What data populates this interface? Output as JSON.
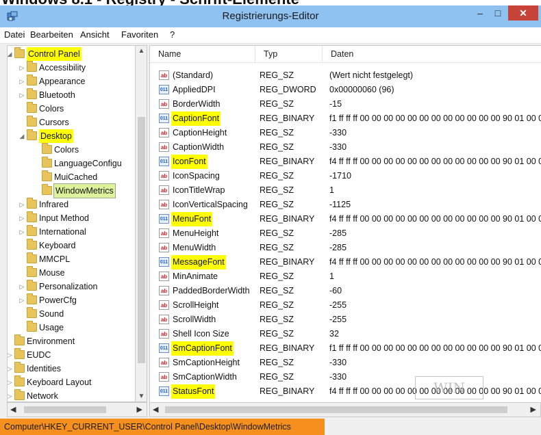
{
  "page_heading": "Windows 8.1 - Registry - Schrift-Elemente",
  "window": {
    "title": "Registrierungs-Editor",
    "controls": {
      "minimize": "–",
      "maximize": "□",
      "close": "✕"
    }
  },
  "menu": [
    "Datei",
    "Bearbeiten",
    "Ansicht",
    "Favoriten",
    "?"
  ],
  "tree": {
    "items": [
      {
        "label": "Control Panel",
        "expander": "◢",
        "highlight": "yellow"
      },
      {
        "label": "Accessibility",
        "expander": "▷"
      },
      {
        "label": "Appearance",
        "expander": "▷"
      },
      {
        "label": "Bluetooth",
        "expander": "▷"
      },
      {
        "label": "Colors",
        "expander": ""
      },
      {
        "label": "Cursors",
        "expander": ""
      },
      {
        "label": "Desktop",
        "expander": "◢",
        "highlight": "yellow"
      },
      {
        "label": "Colors",
        "expander": ""
      },
      {
        "label": "LanguageConfigu",
        "expander": ""
      },
      {
        "label": "MuiCached",
        "expander": ""
      },
      {
        "label": "WindowMetrics",
        "expander": "",
        "highlight": "selected"
      },
      {
        "label": "Infrared",
        "expander": "▷"
      },
      {
        "label": "Input Method",
        "expander": "▷"
      },
      {
        "label": "International",
        "expander": "▷"
      },
      {
        "label": "Keyboard",
        "expander": ""
      },
      {
        "label": "MMCPL",
        "expander": ""
      },
      {
        "label": "Mouse",
        "expander": ""
      },
      {
        "label": "Personalization",
        "expander": "▷"
      },
      {
        "label": "PowerCfg",
        "expander": "▷"
      },
      {
        "label": "Sound",
        "expander": ""
      },
      {
        "label": "Usage",
        "expander": ""
      },
      {
        "label": "Environment",
        "expander": ""
      },
      {
        "label": "EUDC",
        "expander": "▷"
      },
      {
        "label": "Identities",
        "expander": "▷"
      },
      {
        "label": "Keyboard Layout",
        "expander": "▷"
      },
      {
        "label": "Network",
        "expander": "▷"
      }
    ]
  },
  "columns": {
    "name": "Name",
    "type": "Typ",
    "data": "Daten"
  },
  "values": [
    {
      "name": "(Standard)",
      "type": "REG_SZ",
      "data": "(Wert nicht festgelegt)",
      "icon": "ab",
      "highlight": false
    },
    {
      "name": "AppliedDPI",
      "type": "REG_DWORD",
      "data": "0x00000060 (96)",
      "icon": "bin",
      "highlight": false
    },
    {
      "name": "BorderWidth",
      "type": "REG_SZ",
      "data": "-15",
      "icon": "ab",
      "highlight": false
    },
    {
      "name": "CaptionFont",
      "type": "REG_BINARY",
      "data": "f1 ff ff ff 00 00 00 00 00 00 00 00 00 00 00 00 90 01 00 0",
      "icon": "bin",
      "highlight": true
    },
    {
      "name": "CaptionHeight",
      "type": "REG_SZ",
      "data": "-330",
      "icon": "ab",
      "highlight": false
    },
    {
      "name": "CaptionWidth",
      "type": "REG_SZ",
      "data": "-330",
      "icon": "ab",
      "highlight": false
    },
    {
      "name": "IconFont",
      "type": "REG_BINARY",
      "data": "f4 ff ff ff 00 00 00 00 00 00 00 00 00 00 00 00 90 01 00 0",
      "icon": "bin",
      "highlight": true
    },
    {
      "name": "IconSpacing",
      "type": "REG_SZ",
      "data": "-1710",
      "icon": "ab",
      "highlight": false
    },
    {
      "name": "IconTitleWrap",
      "type": "REG_SZ",
      "data": "1",
      "icon": "ab",
      "highlight": false
    },
    {
      "name": "IconVerticalSpacing",
      "type": "REG_SZ",
      "data": "-1125",
      "icon": "ab",
      "highlight": false
    },
    {
      "name": "MenuFont",
      "type": "REG_BINARY",
      "data": "f4 ff ff ff 00 00 00 00 00 00 00 00 00 00 00 00 90 01 00 0",
      "icon": "bin",
      "highlight": true
    },
    {
      "name": "MenuHeight",
      "type": "REG_SZ",
      "data": "-285",
      "icon": "ab",
      "highlight": false
    },
    {
      "name": "MenuWidth",
      "type": "REG_SZ",
      "data": "-285",
      "icon": "ab",
      "highlight": false
    },
    {
      "name": "MessageFont",
      "type": "REG_BINARY",
      "data": "f4 ff ff ff 00 00 00 00 00 00 00 00 00 00 00 00 90 01 00 0",
      "icon": "bin",
      "highlight": true
    },
    {
      "name": "MinAnimate",
      "type": "REG_SZ",
      "data": "1",
      "icon": "ab",
      "highlight": false
    },
    {
      "name": "PaddedBorderWidth",
      "type": "REG_SZ",
      "data": "-60",
      "icon": "ab",
      "highlight": false
    },
    {
      "name": "ScrollHeight",
      "type": "REG_SZ",
      "data": "-255",
      "icon": "ab",
      "highlight": false
    },
    {
      "name": "ScrollWidth",
      "type": "REG_SZ",
      "data": "-255",
      "icon": "ab",
      "highlight": false
    },
    {
      "name": "Shell Icon Size",
      "type": "REG_SZ",
      "data": "32",
      "icon": "ab",
      "highlight": false
    },
    {
      "name": "SmCaptionFont",
      "type": "REG_BINARY",
      "data": "f1 ff ff ff 00 00 00 00 00 00 00 00 00 00 00 00 90 01 00 0",
      "icon": "bin",
      "highlight": true
    },
    {
      "name": "SmCaptionHeight",
      "type": "REG_SZ",
      "data": "-330",
      "icon": "ab",
      "highlight": false
    },
    {
      "name": "SmCaptionWidth",
      "type": "REG_SZ",
      "data": "-330",
      "icon": "ab",
      "highlight": false
    },
    {
      "name": "StatusFont",
      "type": "REG_BINARY",
      "data": "f4 ff ff ff 00 00 00 00 00 00 00 00 00 00 00 00 90 01 00 0",
      "icon": "bin",
      "highlight": true
    }
  ],
  "icons": {
    "sz": "ab",
    "bin": "011"
  },
  "statusbar": {
    "path": "Computer\\HKEY_CURRENT_USER\\Control Panel\\Desktop\\WindowMetrics"
  },
  "watermark": "WIN",
  "colors": {
    "highlight": "#ffff00",
    "statusbar": "#f5901e",
    "selection": "#ddf29b"
  }
}
